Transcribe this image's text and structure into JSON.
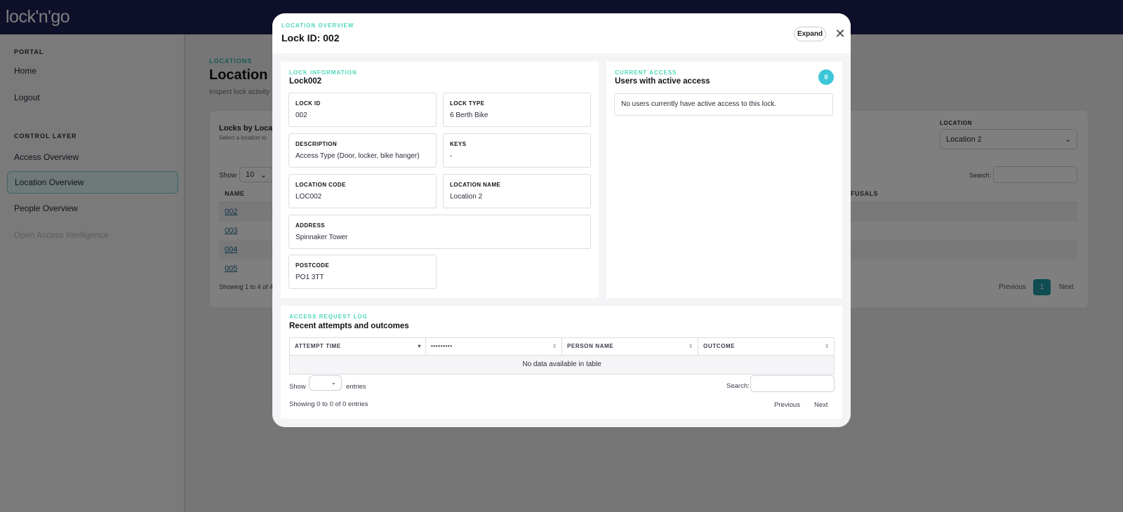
{
  "app": {
    "logo_text": "lock'n'go"
  },
  "sidebar": {
    "section_portal": "PORTAL",
    "section_control": "CONTROL LAYER",
    "items": [
      {
        "label": "Home"
      },
      {
        "label": "Logout"
      },
      {
        "label": "Access Overview"
      },
      {
        "label": "Location Overview"
      },
      {
        "label": "People Overview"
      },
      {
        "label": "Open Access Intelligence"
      }
    ]
  },
  "page": {
    "eyebrow": "LOCATIONS",
    "title": "Location",
    "subtitle": "Inspect lock activity",
    "card_title": "Locks by Locat",
    "card_subtitle": "Select a location to",
    "location_label": "LOCATION",
    "location_value": "Location 2",
    "show_label": "Show",
    "show_value": "10",
    "search_label": "Search:",
    "col_name": "NAME",
    "col_refusals": "FUSALS",
    "rows": [
      "002",
      "003",
      "004",
      "005"
    ],
    "showing": "Showing 1 to 4 of 4",
    "previous": "Previous",
    "page_num": "1",
    "next": "Next"
  },
  "modal": {
    "eyebrow": "LOCATION OVERVIEW",
    "title": "Lock ID: 002",
    "expand_label": "Expand",
    "close_glyph": "✕",
    "lock_info": {
      "eyebrow": "LOCK INFORMATION",
      "title": "Lock002",
      "fields": {
        "lock_id": {
          "label": "LOCK ID",
          "value": "002"
        },
        "lock_type": {
          "label": "LOCK TYPE",
          "value": "6 Berth Bike"
        },
        "description": {
          "label": "DESCRIPTION",
          "value": "Access Type (Door, locker, bike hanger)"
        },
        "keys": {
          "label": "KEYS",
          "value": "-"
        },
        "location_code": {
          "label": "LOCATION CODE",
          "value": "LOC002"
        },
        "location_name": {
          "label": "LOCATION NAME",
          "value": "Location 2"
        },
        "address": {
          "label": "ADDRESS",
          "value": "Spinnaker Tower"
        },
        "postcode": {
          "label": "POSTCODE",
          "value": "PO1 3TT"
        }
      }
    },
    "current_access": {
      "eyebrow": "CURRENT ACCESS",
      "title": "Users with active access",
      "count": "0",
      "empty_message": "No users currently have active access to this lock."
    },
    "access_log": {
      "eyebrow": "ACCESS REQUEST LOG",
      "title": "Recent attempts and outcomes",
      "columns": [
        "ATTEMPT TIME",
        "•••••••••",
        "PERSON NAME",
        "OUTCOME"
      ],
      "empty_row": "No data available in table",
      "show_label": "Show",
      "entries_label": "entries",
      "search_label": "Search:",
      "showing": "Showing 0 to 0 of 0 entries",
      "previous": "Previous",
      "next": "Next"
    }
  }
}
